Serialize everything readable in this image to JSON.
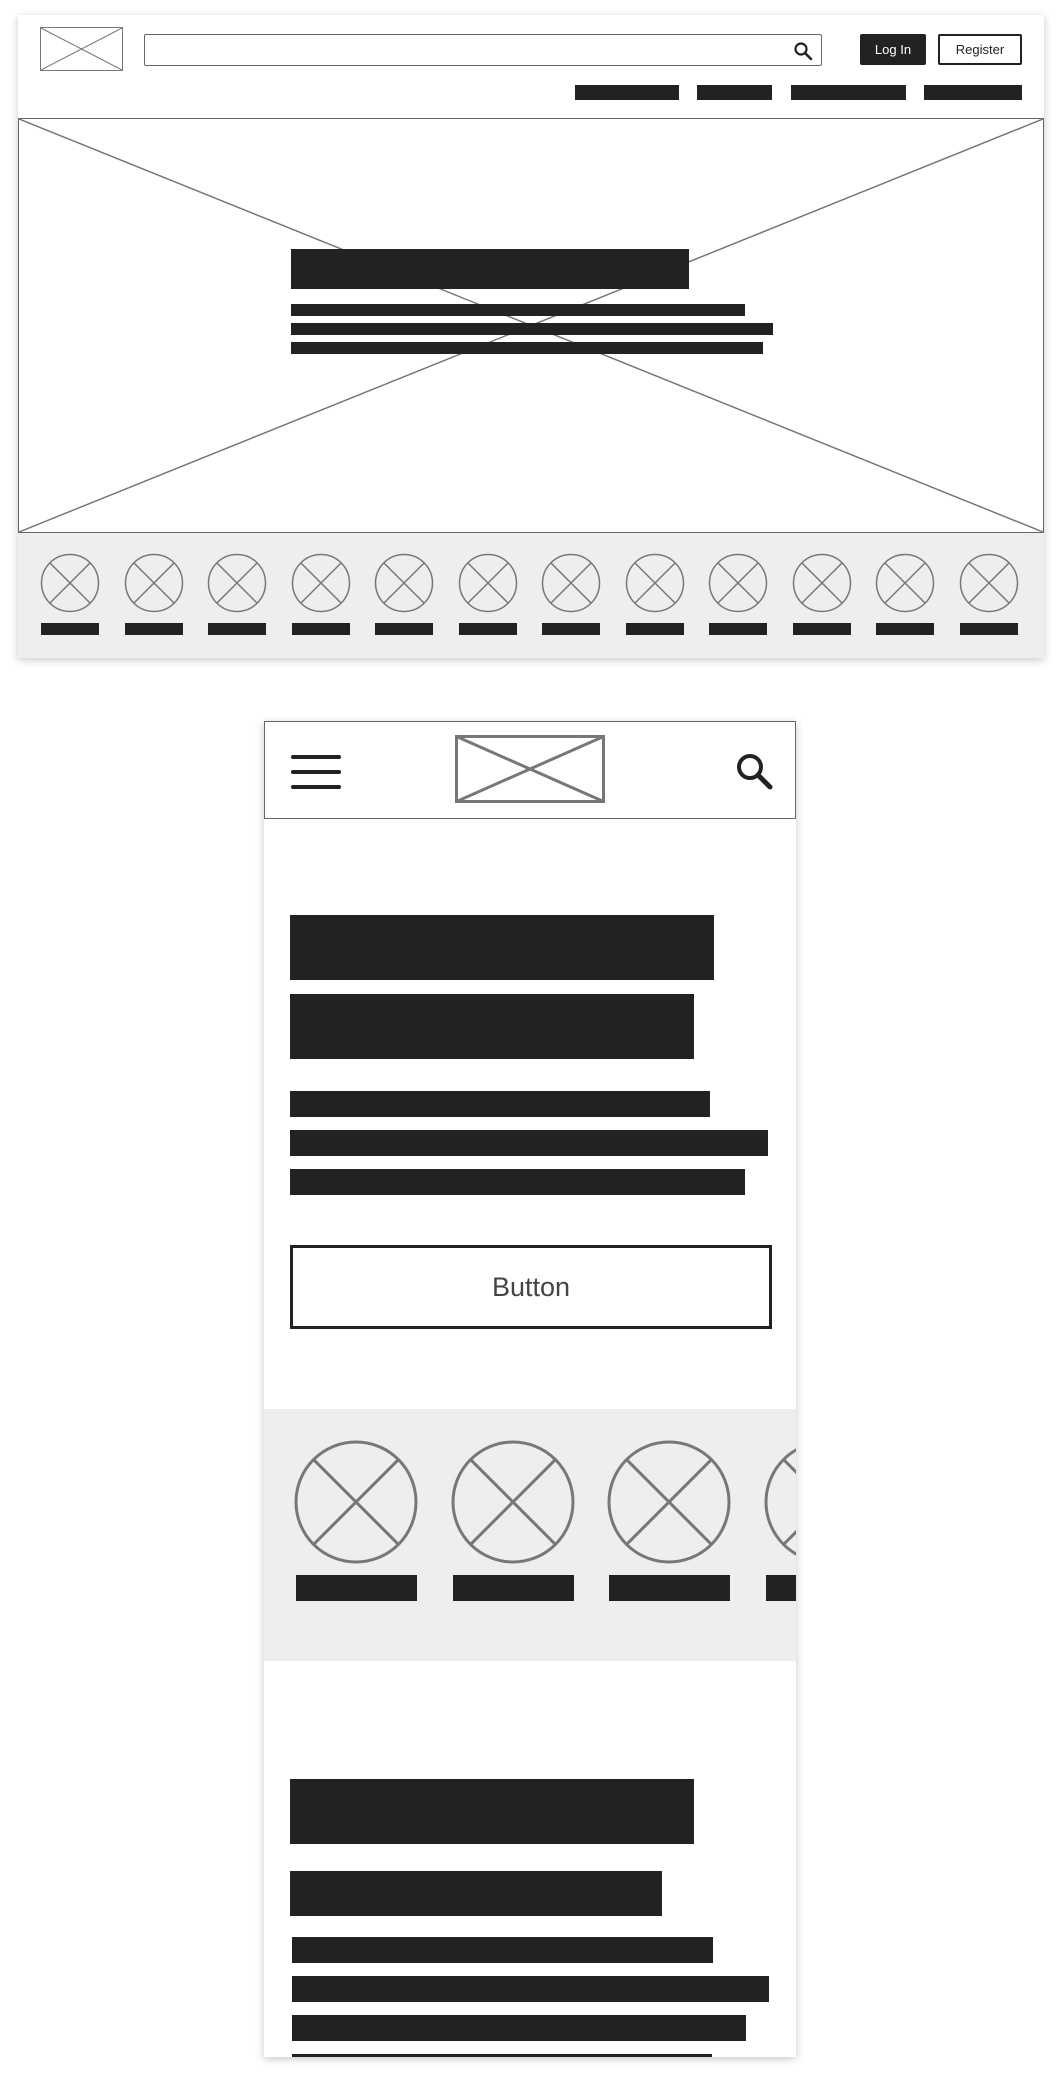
{
  "desktop": {
    "header": {
      "logo_icon": "image-placeholder-icon",
      "search": {
        "value": "",
        "placeholder": "",
        "icon": "search-icon"
      },
      "login_label": "Log In",
      "register_label": "Register",
      "nav_items": 4
    },
    "hero": {
      "image_icon": "image-placeholder-icon"
    },
    "category_strip": {
      "item_count": 12,
      "icon": "image-placeholder-icon"
    }
  },
  "mobile": {
    "header": {
      "menu_icon": "hamburger-menu-icon",
      "logo_icon": "image-placeholder-icon",
      "search_icon": "search-icon"
    },
    "cta_label": "Button",
    "category_strip": {
      "item_count": 4,
      "icon": "image-placeholder-icon"
    }
  },
  "colors": {
    "ink": "#222222",
    "outline": "#777777",
    "strip_background": "#eeeeee",
    "page_background": "#ffffff"
  }
}
